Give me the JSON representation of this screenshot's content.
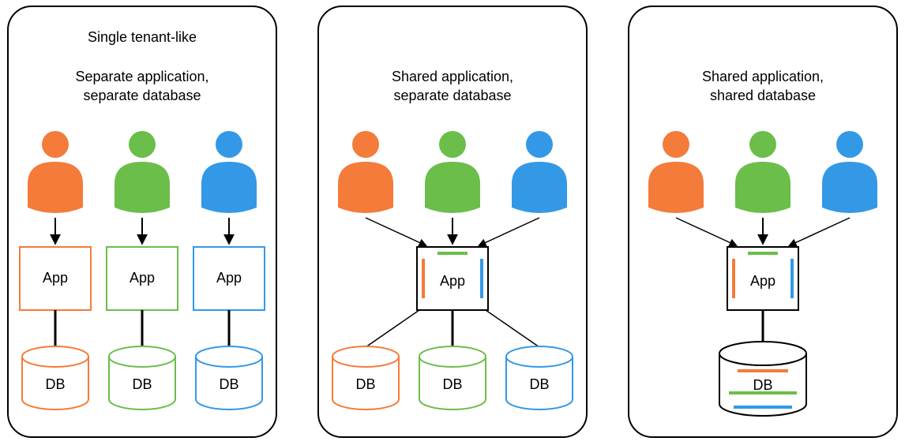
{
  "colors": {
    "orange": "#f47b3a",
    "green": "#6bbe4a",
    "blue": "#3399e6",
    "black": "#000000"
  },
  "labels": {
    "app": "App",
    "db": "DB"
  },
  "panels": [
    {
      "id": "panel-1-separate-app-separate-db",
      "title_line1": "Single tenant-like",
      "title_line2": "Separate application,",
      "title_line3": "separate database",
      "mode": "separate_all"
    },
    {
      "id": "panel-2-shared-app-separate-db",
      "title_line1": "",
      "title_line2": "Shared application,",
      "title_line3": "separate database",
      "mode": "shared_app_sep_db"
    },
    {
      "id": "panel-3-shared-app-shared-db",
      "title_line1": "",
      "title_line2": "Shared application,",
      "title_line3": "shared database",
      "mode": "shared_all"
    }
  ]
}
